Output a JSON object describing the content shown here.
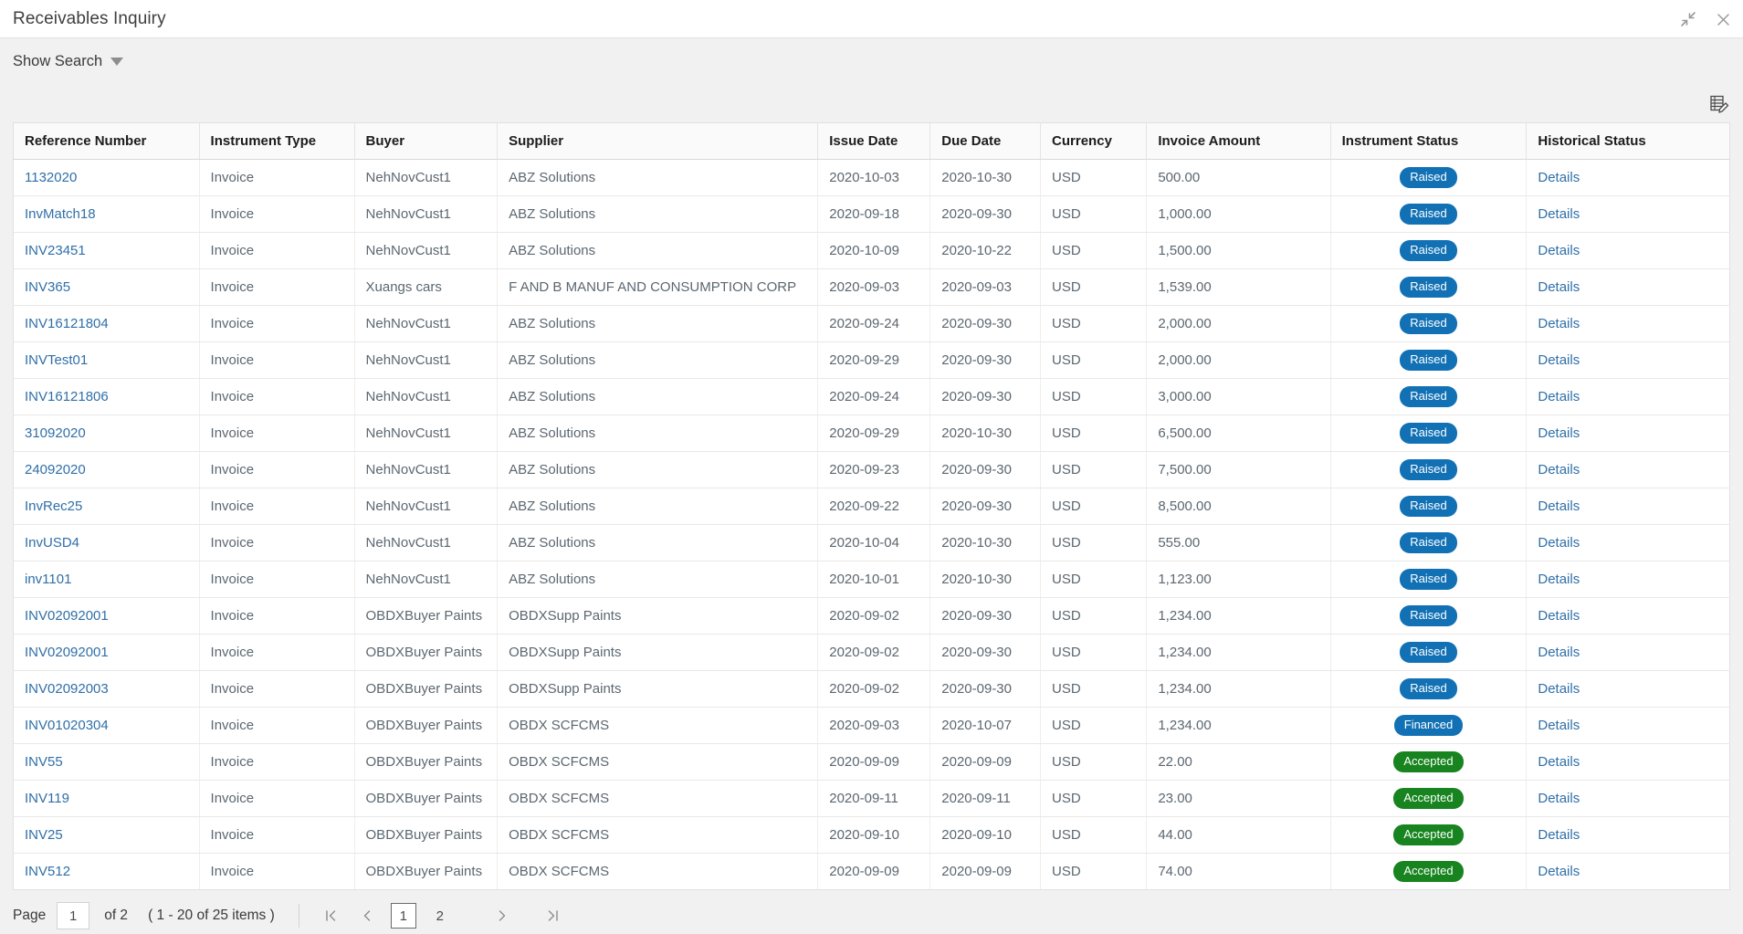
{
  "window": {
    "title": "Receivables Inquiry",
    "collapse_icon": "collapse-arrows-icon",
    "close_icon": "close-icon"
  },
  "toolbar": {
    "show_search_label": "Show Search",
    "caret_icon": "chevron-down-icon",
    "grid_edit_icon": "grid-edit-icon"
  },
  "table": {
    "columns": [
      "Reference Number",
      "Instrument Type",
      "Buyer",
      "Supplier",
      "Issue Date",
      "Due Date",
      "Currency",
      "Invoice Amount",
      "Instrument Status",
      "Historical Status"
    ],
    "details_label": "Details",
    "rows": [
      {
        "ref": "1132020",
        "type": "Invoice",
        "buyer": "NehNovCust1",
        "supplier": "ABZ Solutions",
        "issue": "2020-10-03",
        "due": "2020-10-30",
        "ccy": "USD",
        "amount": "500.00",
        "status": "Raised",
        "status_color": "blue",
        "historical": "Details"
      },
      {
        "ref": "InvMatch18",
        "type": "Invoice",
        "buyer": "NehNovCust1",
        "supplier": "ABZ Solutions",
        "issue": "2020-09-18",
        "due": "2020-09-30",
        "ccy": "USD",
        "amount": "1,000.00",
        "status": "Raised",
        "status_color": "blue",
        "historical": "Details"
      },
      {
        "ref": "INV23451",
        "type": "Invoice",
        "buyer": "NehNovCust1",
        "supplier": "ABZ Solutions",
        "issue": "2020-10-09",
        "due": "2020-10-22",
        "ccy": "USD",
        "amount": "1,500.00",
        "status": "Raised",
        "status_color": "blue",
        "historical": "Details"
      },
      {
        "ref": "INV365",
        "type": "Invoice",
        "buyer": "Xuangs cars",
        "supplier": "F AND B MANUF AND CONSUMPTION CORP",
        "issue": "2020-09-03",
        "due": "2020-09-03",
        "ccy": "USD",
        "amount": "1,539.00",
        "status": "Raised",
        "status_color": "blue",
        "historical": "Details"
      },
      {
        "ref": "INV16121804",
        "type": "Invoice",
        "buyer": "NehNovCust1",
        "supplier": "ABZ Solutions",
        "issue": "2020-09-24",
        "due": "2020-09-30",
        "ccy": "USD",
        "amount": "2,000.00",
        "status": "Raised",
        "status_color": "blue",
        "historical": "Details"
      },
      {
        "ref": "INVTest01",
        "type": "Invoice",
        "buyer": "NehNovCust1",
        "supplier": "ABZ Solutions",
        "issue": "2020-09-29",
        "due": "2020-09-30",
        "ccy": "USD",
        "amount": "2,000.00",
        "status": "Raised",
        "status_color": "blue",
        "historical": "Details"
      },
      {
        "ref": "INV16121806",
        "type": "Invoice",
        "buyer": "NehNovCust1",
        "supplier": "ABZ Solutions",
        "issue": "2020-09-24",
        "due": "2020-09-30",
        "ccy": "USD",
        "amount": "3,000.00",
        "status": "Raised",
        "status_color": "blue",
        "historical": "Details"
      },
      {
        "ref": "31092020",
        "type": "Invoice",
        "buyer": "NehNovCust1",
        "supplier": "ABZ Solutions",
        "issue": "2020-09-29",
        "due": "2020-10-30",
        "ccy": "USD",
        "amount": "6,500.00",
        "status": "Raised",
        "status_color": "blue",
        "historical": "Details"
      },
      {
        "ref": "24092020",
        "type": "Invoice",
        "buyer": "NehNovCust1",
        "supplier": "ABZ Solutions",
        "issue": "2020-09-23",
        "due": "2020-09-30",
        "ccy": "USD",
        "amount": "7,500.00",
        "status": "Raised",
        "status_color": "blue",
        "historical": "Details"
      },
      {
        "ref": "InvRec25",
        "type": "Invoice",
        "buyer": "NehNovCust1",
        "supplier": "ABZ Solutions",
        "issue": "2020-09-22",
        "due": "2020-09-30",
        "ccy": "USD",
        "amount": "8,500.00",
        "status": "Raised",
        "status_color": "blue",
        "historical": "Details"
      },
      {
        "ref": "InvUSD4",
        "type": "Invoice",
        "buyer": "NehNovCust1",
        "supplier": "ABZ Solutions",
        "issue": "2020-10-04",
        "due": "2020-10-30",
        "ccy": "USD",
        "amount": "555.00",
        "status": "Raised",
        "status_color": "blue",
        "historical": "Details"
      },
      {
        "ref": "inv1101",
        "type": "Invoice",
        "buyer": "NehNovCust1",
        "supplier": "ABZ Solutions",
        "issue": "2020-10-01",
        "due": "2020-10-30",
        "ccy": "USD",
        "amount": "1,123.00",
        "status": "Raised",
        "status_color": "blue",
        "historical": "Details"
      },
      {
        "ref": "INV02092001",
        "type": "Invoice",
        "buyer": "OBDXBuyer Paints",
        "supplier": "OBDXSupp Paints",
        "issue": "2020-09-02",
        "due": "2020-09-30",
        "ccy": "USD",
        "amount": "1,234.00",
        "status": "Raised",
        "status_color": "blue",
        "historical": "Details"
      },
      {
        "ref": "INV02092001",
        "type": "Invoice",
        "buyer": "OBDXBuyer Paints",
        "supplier": "OBDXSupp Paints",
        "issue": "2020-09-02",
        "due": "2020-09-30",
        "ccy": "USD",
        "amount": "1,234.00",
        "status": "Raised",
        "status_color": "blue",
        "historical": "Details"
      },
      {
        "ref": "INV02092003",
        "type": "Invoice",
        "buyer": "OBDXBuyer Paints",
        "supplier": "OBDXSupp Paints",
        "issue": "2020-09-02",
        "due": "2020-09-30",
        "ccy": "USD",
        "amount": "1,234.00",
        "status": "Raised",
        "status_color": "blue",
        "historical": "Details"
      },
      {
        "ref": "INV01020304",
        "type": "Invoice",
        "buyer": "OBDXBuyer Paints",
        "supplier": "OBDX SCFCMS",
        "issue": "2020-09-03",
        "due": "2020-10-07",
        "ccy": "USD",
        "amount": "1,234.00",
        "status": "Financed",
        "status_color": "blue",
        "historical": "Details"
      },
      {
        "ref": "INV55",
        "type": "Invoice",
        "buyer": "OBDXBuyer Paints",
        "supplier": "OBDX SCFCMS",
        "issue": "2020-09-09",
        "due": "2020-09-09",
        "ccy": "USD",
        "amount": "22.00",
        "status": "Accepted",
        "status_color": "green",
        "historical": "Details"
      },
      {
        "ref": "INV119",
        "type": "Invoice",
        "buyer": "OBDXBuyer Paints",
        "supplier": "OBDX SCFCMS",
        "issue": "2020-09-11",
        "due": "2020-09-11",
        "ccy": "USD",
        "amount": "23.00",
        "status": "Accepted",
        "status_color": "green",
        "historical": "Details"
      },
      {
        "ref": "INV25",
        "type": "Invoice",
        "buyer": "OBDXBuyer Paints",
        "supplier": "OBDX SCFCMS",
        "issue": "2020-09-10",
        "due": "2020-09-10",
        "ccy": "USD",
        "amount": "44.00",
        "status": "Accepted",
        "status_color": "green",
        "historical": "Details"
      },
      {
        "ref": "INV512",
        "type": "Invoice",
        "buyer": "OBDXBuyer Paints",
        "supplier": "OBDX SCFCMS",
        "issue": "2020-09-09",
        "due": "2020-09-09",
        "ccy": "USD",
        "amount": "74.00",
        "status": "Accepted",
        "status_color": "green",
        "historical": "Details"
      }
    ]
  },
  "pager": {
    "page_label": "Page",
    "page_value": "1",
    "of_label": "of 2",
    "items_label": "( 1 - 20 of 25 items )",
    "first_icon": "first-page-icon",
    "prev_icon": "previous-page-icon",
    "next_icon": "next-page-icon",
    "last_icon": "last-page-icon",
    "pages": [
      "1",
      "2"
    ],
    "active_page": "1"
  },
  "colors": {
    "link": "#2f6fa8",
    "badge_blue": "#1271b5",
    "badge_green": "#17841f",
    "toolbar_bg": "#f1f1f1"
  }
}
